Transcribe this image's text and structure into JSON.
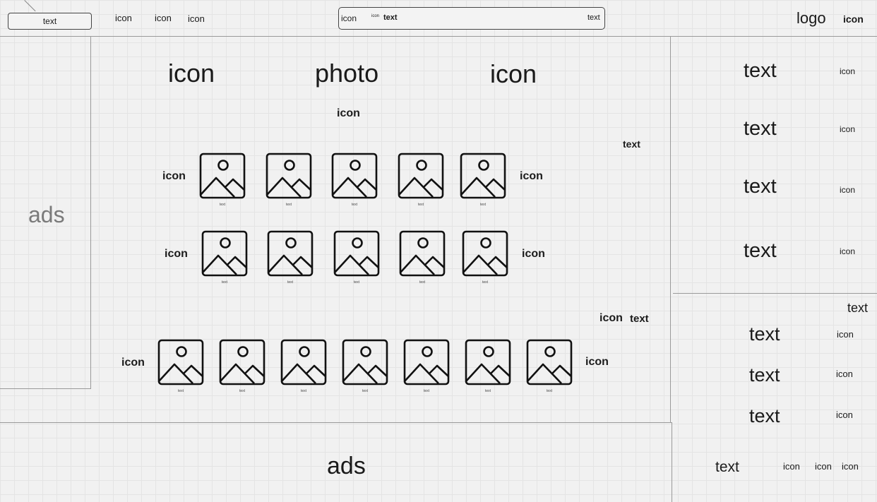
{
  "header": {
    "button_label": "text",
    "nav_icons": [
      "icon",
      "icon",
      "icon"
    ],
    "search": {
      "icon_label": "icon",
      "inner_icon_label": "icon",
      "query_text": "text",
      "action_label": "text"
    },
    "logo": "logo",
    "user_icon": "icon"
  },
  "left_ad": "ads",
  "bottom_ad": "ads",
  "main": {
    "top_row": [
      "icon",
      "photo",
      "icon"
    ],
    "section1": {
      "title_icon": "icon",
      "right_label": "text",
      "row1": {
        "left_icon": "icon",
        "right_icon": "icon",
        "captions": [
          "text",
          "text",
          "text",
          "text",
          "text"
        ]
      },
      "row2": {
        "left_icon": "icon",
        "right_icon": "icon",
        "captions": [
          "text",
          "text",
          "text",
          "text",
          "text"
        ]
      }
    },
    "section2": {
      "header_icon": "icon",
      "header_text": "text",
      "row": {
        "left_icon": "icon",
        "right_icon": "icon",
        "captions": [
          "text",
          "text",
          "text",
          "text",
          "text",
          "text",
          "text"
        ]
      }
    }
  },
  "right_panel": {
    "list": [
      {
        "text": "text",
        "icon": "icon"
      },
      {
        "text": "text",
        "icon": "icon"
      },
      {
        "text": "text",
        "icon": "icon"
      },
      {
        "text": "text",
        "icon": "icon"
      }
    ],
    "lower": {
      "title": "text",
      "items": [
        {
          "text": "text",
          "icon": "icon"
        },
        {
          "text": "text",
          "icon": "icon"
        },
        {
          "text": "text",
          "icon": "icon"
        }
      ],
      "footer": {
        "text": "text",
        "icons": [
          "icon",
          "icon",
          "icon"
        ]
      }
    }
  }
}
